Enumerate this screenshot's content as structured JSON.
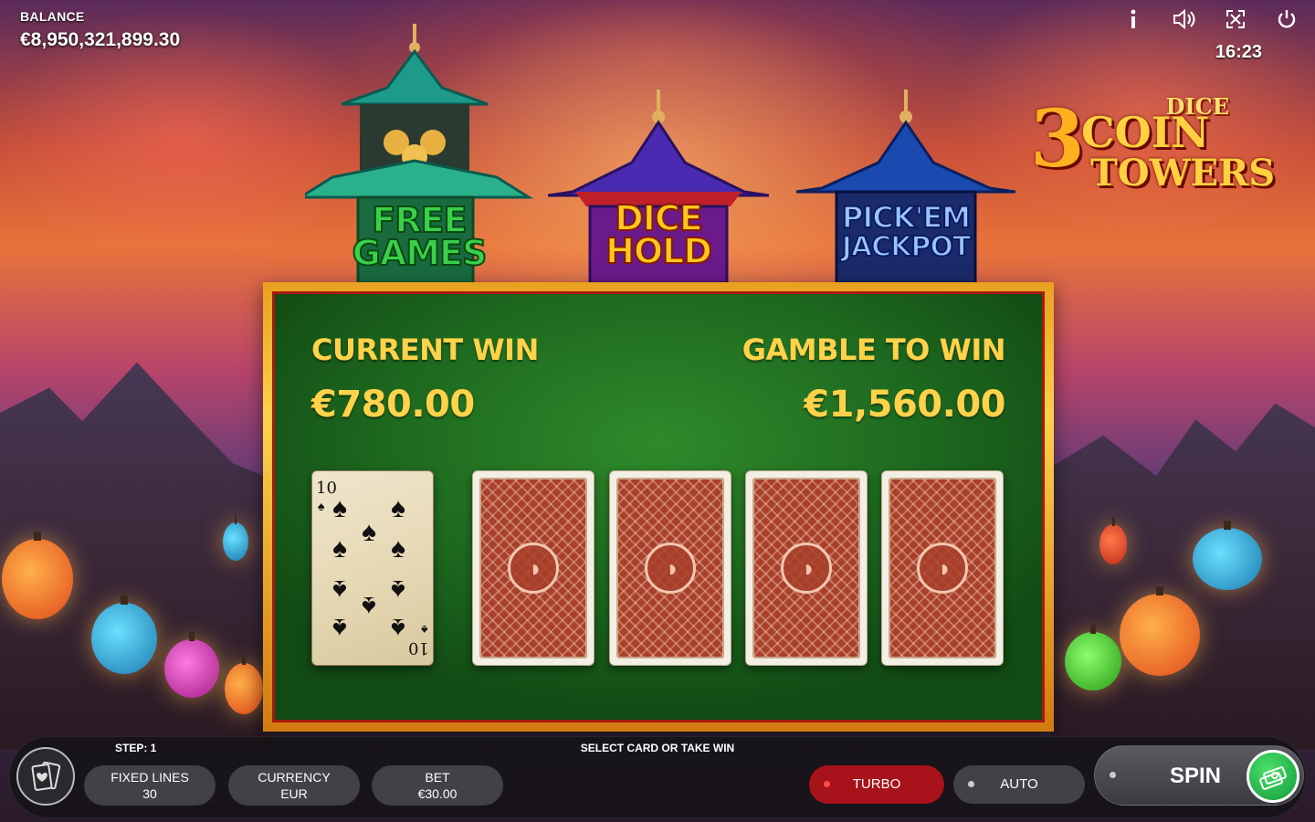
{
  "balance": {
    "label": "BALANCE",
    "value": "€8,950,321,899.30"
  },
  "top_icons": [
    "info-icon",
    "sound-icon",
    "fullscreen-icon",
    "power-icon"
  ],
  "clock": "16:23",
  "logo": {
    "dice": "DICE",
    "three": "3",
    "coin": "COIN",
    "towers": "TOWERS"
  },
  "towers": [
    {
      "label_1": "FREE",
      "label_2": "GAMES",
      "color": "#3ad04a"
    },
    {
      "label_1": "DICE",
      "label_2": "HOLD",
      "color": "#ffc820"
    },
    {
      "label_1": "PICK'EM",
      "label_2": "JACKPOT",
      "color": "#7ab0ff"
    }
  ],
  "gamble": {
    "current_win_label": "CURRENT WIN",
    "current_win_value": "€780.00",
    "gamble_to_win_label": "GAMBLE TO WIN",
    "gamble_to_win_value": "€1,560.00",
    "dealer_card": {
      "rank": "10",
      "suit": "♠"
    },
    "face_down_cards": 4
  },
  "status": {
    "step": "STEP: 1",
    "message": "SELECT CARD OR TAKE WIN"
  },
  "controls": {
    "fixed_lines_label": "FIXED LINES",
    "fixed_lines_value": "30",
    "currency_label": "CURRENCY",
    "currency_value": "EUR",
    "bet_label": "BET",
    "bet_value": "€30.00",
    "turbo_label": "TURBO",
    "auto_label": "AUTO",
    "spin_label": "SPIN"
  },
  "colors": {
    "accent_gold": "#ffd24a",
    "felt_green": "#1e6a20",
    "turbo_red": "#a8121a",
    "spin_green": "#149a3a"
  }
}
